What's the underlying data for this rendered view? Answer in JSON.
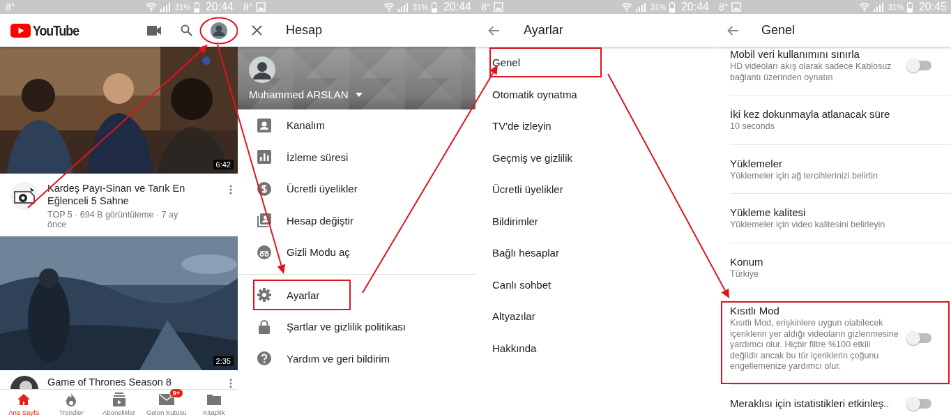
{
  "panels": [
    {
      "kind": "home",
      "status_bar": {
        "temperature": "8°",
        "image_notification": false,
        "battery": "31%",
        "time": "20:44"
      },
      "app_bar": {
        "logo": "YouTube",
        "avatar_circled": true
      },
      "videos": [
        {
          "title": "Kardeş Payı-Sinan ve Tarık En Eğlenceli 5 Sahne",
          "meta": "TOP 5 · 694 B görüntüleme · 7 ay önce",
          "duration": "6:42"
        },
        {
          "title": "Game of Thrones Season 8",
          "duration": "2:35"
        }
      ],
      "nav": [
        {
          "label": "Ana Sayfa",
          "selected": true
        },
        {
          "label": "Trendler",
          "selected": false
        },
        {
          "label": "Abonelikler",
          "selected": false
        },
        {
          "label": "Gelen Kutusu",
          "selected": false,
          "badge": "9+"
        },
        {
          "label": "Kitaplık",
          "selected": false
        }
      ]
    },
    {
      "kind": "account",
      "status_bar": {
        "temperature": "8°",
        "image_notification": true,
        "battery": "31%",
        "time": "20:44"
      },
      "title": "Hesap",
      "user": "Muhammed ARSLAN",
      "menu_groups": [
        [
          {
            "label": "Kanalım",
            "highlighted": false
          },
          {
            "label": "İzleme süresi",
            "highlighted": false
          },
          {
            "label": "Ücretli üyelikler",
            "highlighted": false
          },
          {
            "label": "Hesap değiştir",
            "highlighted": false
          },
          {
            "label": "Gizli Modu aç",
            "highlighted": false
          }
        ],
        [
          {
            "label": "Ayarlar",
            "highlighted": true
          },
          {
            "label": "Şartlar ve gizlilik politikası",
            "highlighted": false
          },
          {
            "label": "Yardım ve geri bildirim",
            "highlighted": false
          }
        ]
      ]
    },
    {
      "kind": "settings",
      "status_bar": {
        "temperature": "8°",
        "image_notification": true,
        "battery": "31%",
        "time": "20:44"
      },
      "title": "Ayarlar",
      "items": [
        {
          "label": "Genel",
          "highlighted": true
        },
        {
          "label": "Otomatik oynatma",
          "highlighted": false
        },
        {
          "label": "TV'de izleyin",
          "highlighted": false
        },
        {
          "label": "Geçmiş ve gizlilik",
          "highlighted": false
        },
        {
          "label": "Ücretli üyelikler",
          "highlighted": false
        },
        {
          "label": "Bildirimler",
          "highlighted": false
        },
        {
          "label": "Bağlı hesaplar",
          "highlighted": false
        },
        {
          "label": "Canlı sohbet",
          "highlighted": false
        },
        {
          "label": "Altyazılar",
          "highlighted": false
        },
        {
          "label": "Hakkında",
          "highlighted": false
        }
      ]
    },
    {
      "kind": "general",
      "status_bar": {
        "temperature": "8°",
        "image_notification": true,
        "battery": "31%",
        "time": "20:45"
      },
      "title": "Genel",
      "items": [
        {
          "title": "Mobil veri kullanımını sınırla",
          "subtitle": "HD videoları akış olarak sadece Kablosuz bağlantı üzerinden oynatın",
          "toggle": {
            "on": false
          },
          "highlighted": false
        },
        {
          "title": "İki kez dokunmayla atlanacak süre",
          "subtitle": "10 seconds",
          "highlighted": false
        },
        {
          "title": "Yüklemeler",
          "subtitle": "Yüklemeler için ağ tercihlerinizi belirtin",
          "highlighted": false
        },
        {
          "title": "Yükleme kalitesi",
          "subtitle": "Yüklemeler için video kalitesini belirleyin",
          "highlighted": false
        },
        {
          "title": "Konum",
          "subtitle": "Türkiye",
          "highlighted": false
        },
        {
          "title": "Kısıtlı Mod",
          "subtitle": "Kısıtlı Mod, erişkinlere uygun olabilecek içeriklerin yer aldığı videoların gizlenmesine yardımcı olur. Hiçbir filtre %100 etkili değildir ancak bu tür içeriklerin çoğunu engellemenize yardımcı olur.",
          "toggle": {
            "on": false
          },
          "highlighted": true
        },
        {
          "title": "Meraklısı için istatistikleri etkinleş..",
          "toggle": {
            "on": false
          },
          "highlighted": false
        }
      ]
    }
  ]
}
